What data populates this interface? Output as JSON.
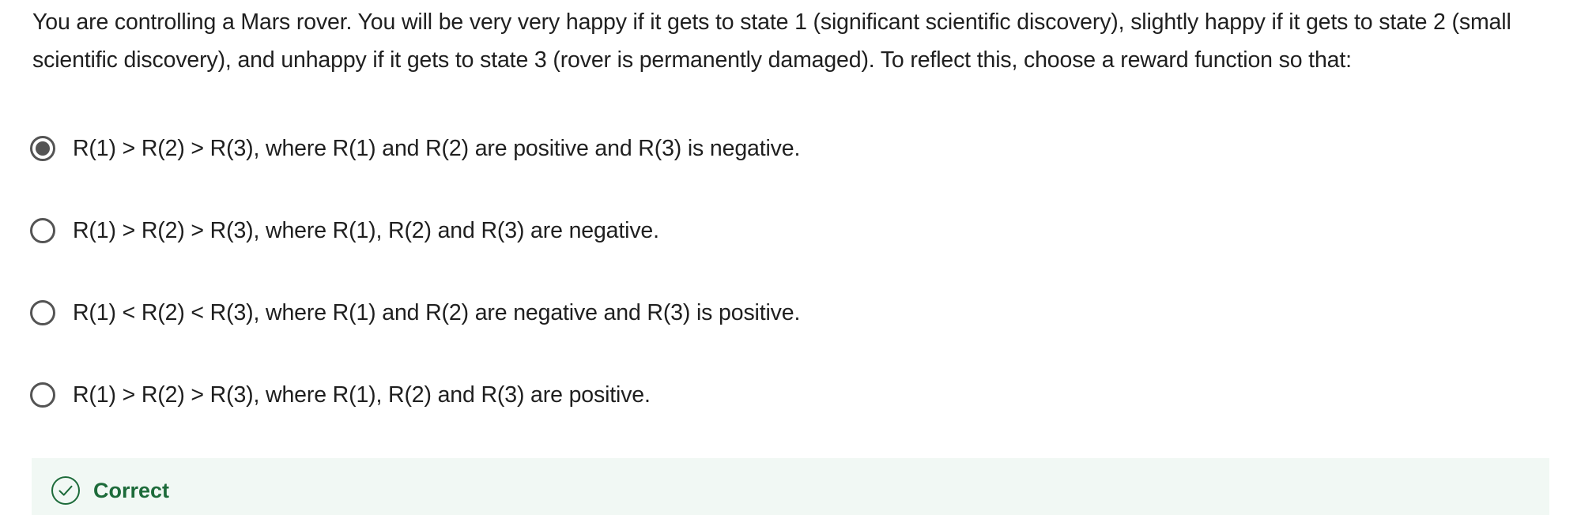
{
  "question": {
    "text": "You are controlling a Mars rover. You will be very very happy if it gets to state 1 (significant scientific discovery), slightly happy if it gets to state 2 (small scientific discovery), and unhappy if it gets to state 3 (rover is permanently damaged). To reflect this, choose a reward function so that:"
  },
  "options": [
    {
      "label": "R(1) > R(2) > R(3), where R(1) and R(2) are positive and R(3) is negative.",
      "selected": true
    },
    {
      "label": "R(1) > R(2) > R(3), where R(1), R(2) and R(3) are negative.",
      "selected": false
    },
    {
      "label": "R(1) < R(2) < R(3), where R(1) and R(2) are negative and R(3) is positive.",
      "selected": false
    },
    {
      "label": "R(1) > R(2) > R(3), where R(1), R(2) and R(3) are positive.",
      "selected": false
    }
  ],
  "feedback": {
    "status": "Correct",
    "icon": "check-circle-icon",
    "color": "#1d6b3a",
    "background": "#f1f8f4"
  }
}
